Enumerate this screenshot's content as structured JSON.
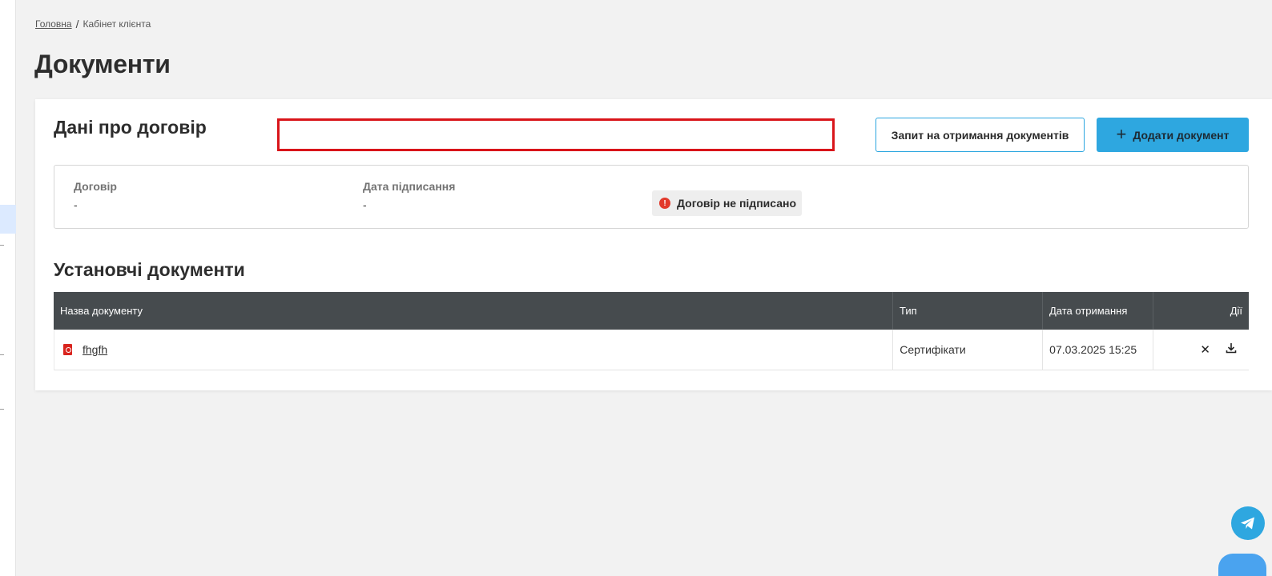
{
  "breadcrumb": {
    "home": "Головна",
    "separator": "/",
    "current": "Кабінет клієнта"
  },
  "page": {
    "title": "Документи"
  },
  "contract": {
    "title": "Дані про договір",
    "request_button": "Запит на отримання документів",
    "add_button": "Додати документ",
    "add_icon": "+",
    "fields": [
      {
        "label": "Договір",
        "value": "-"
      },
      {
        "label": "Дата підписання",
        "value": "-"
      }
    ],
    "status": {
      "icon": "!",
      "text": "Договір не підписано"
    }
  },
  "documents": {
    "title": "Установчі документи",
    "columns": [
      "Назва документу",
      "Тип",
      "Дата отримання",
      "Дії"
    ],
    "rows": [
      {
        "name": "fhgfh",
        "type": "Сертифікати",
        "date": "07.03.2025 15:25"
      }
    ],
    "action_icons": {
      "delete": "✕",
      "download": "download-icon"
    }
  },
  "colors": {
    "accent": "#2ea7e0",
    "header_bg": "#464b4e",
    "error": "#e23a2c",
    "highlight": "#d9151a"
  }
}
